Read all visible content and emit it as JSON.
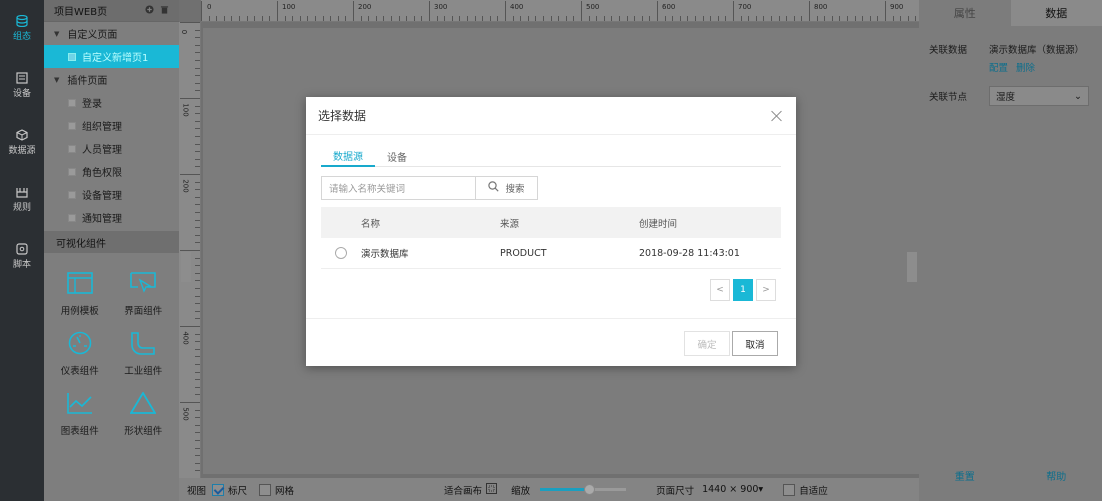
{
  "nav": [
    {
      "label": "组态",
      "icon": "database-icon",
      "active": true
    },
    {
      "label": "设备",
      "icon": "device-icon"
    },
    {
      "label": "数据源",
      "icon": "cube-icon"
    },
    {
      "label": "规则",
      "icon": "rule-icon"
    },
    {
      "label": "脚本",
      "icon": "script-icon"
    }
  ],
  "panel": {
    "title": "项目WEB页",
    "tree": [
      {
        "label": "自定义页面",
        "level": 0
      },
      {
        "label": "自定义新增页1",
        "level": 1,
        "selected": true
      },
      {
        "label": "插件页面",
        "level": 0
      },
      {
        "label": "登录",
        "level": 1
      },
      {
        "label": "组织管理",
        "level": 1
      },
      {
        "label": "人员管理",
        "level": 1
      },
      {
        "label": "角色权限",
        "level": 1
      },
      {
        "label": "设备管理",
        "level": 1
      },
      {
        "label": "通知管理",
        "level": 1
      }
    ],
    "components_title": "可视化组件",
    "components": [
      {
        "label": "用例模板",
        "icon": "template-icon"
      },
      {
        "label": "界面组件",
        "icon": "ui-component-icon"
      },
      {
        "label": "仪表组件",
        "icon": "gauge-icon"
      },
      {
        "label": "工业组件",
        "icon": "pipe-icon"
      },
      {
        "label": "图表组件",
        "icon": "chart-icon"
      },
      {
        "label": "形状组件",
        "icon": "triangle-icon"
      }
    ]
  },
  "ruler": {
    "top": [
      "0",
      "100",
      "200",
      "300",
      "400",
      "500",
      "600",
      "700",
      "800",
      "900"
    ],
    "left": [
      "0",
      "100",
      "200",
      "300",
      "400",
      "500"
    ]
  },
  "bottombar": {
    "view": "视图",
    "ruler": "标尺",
    "grid": "网格",
    "fit": "适合画布",
    "zoom": "缩放",
    "page_size_label": "页面尺寸",
    "page_size": "1440 × 900",
    "adaptive": "自适应"
  },
  "right": {
    "tab_props": "属性",
    "tab_data": "数据",
    "rel_data_label": "关联数据",
    "rel_data_value": "演示数据库（数据源）",
    "config": "配置",
    "delete": "删除",
    "rel_node_label": "关联节点",
    "rel_node_value": "湿度",
    "reset": "重置",
    "help": "帮助"
  },
  "dialog": {
    "title": "选择数据",
    "tab_source": "数据源",
    "tab_device": "设备",
    "search_placeholder": "请输入名称关键词",
    "search_btn": "搜索",
    "columns": [
      "名称",
      "来源",
      "创建时间"
    ],
    "rows": [
      {
        "name": "演示数据库",
        "source": "PRODUCT",
        "created": "2018-09-28 11:43:01"
      }
    ],
    "page": "1",
    "ok": "确定",
    "cancel": "取消"
  }
}
